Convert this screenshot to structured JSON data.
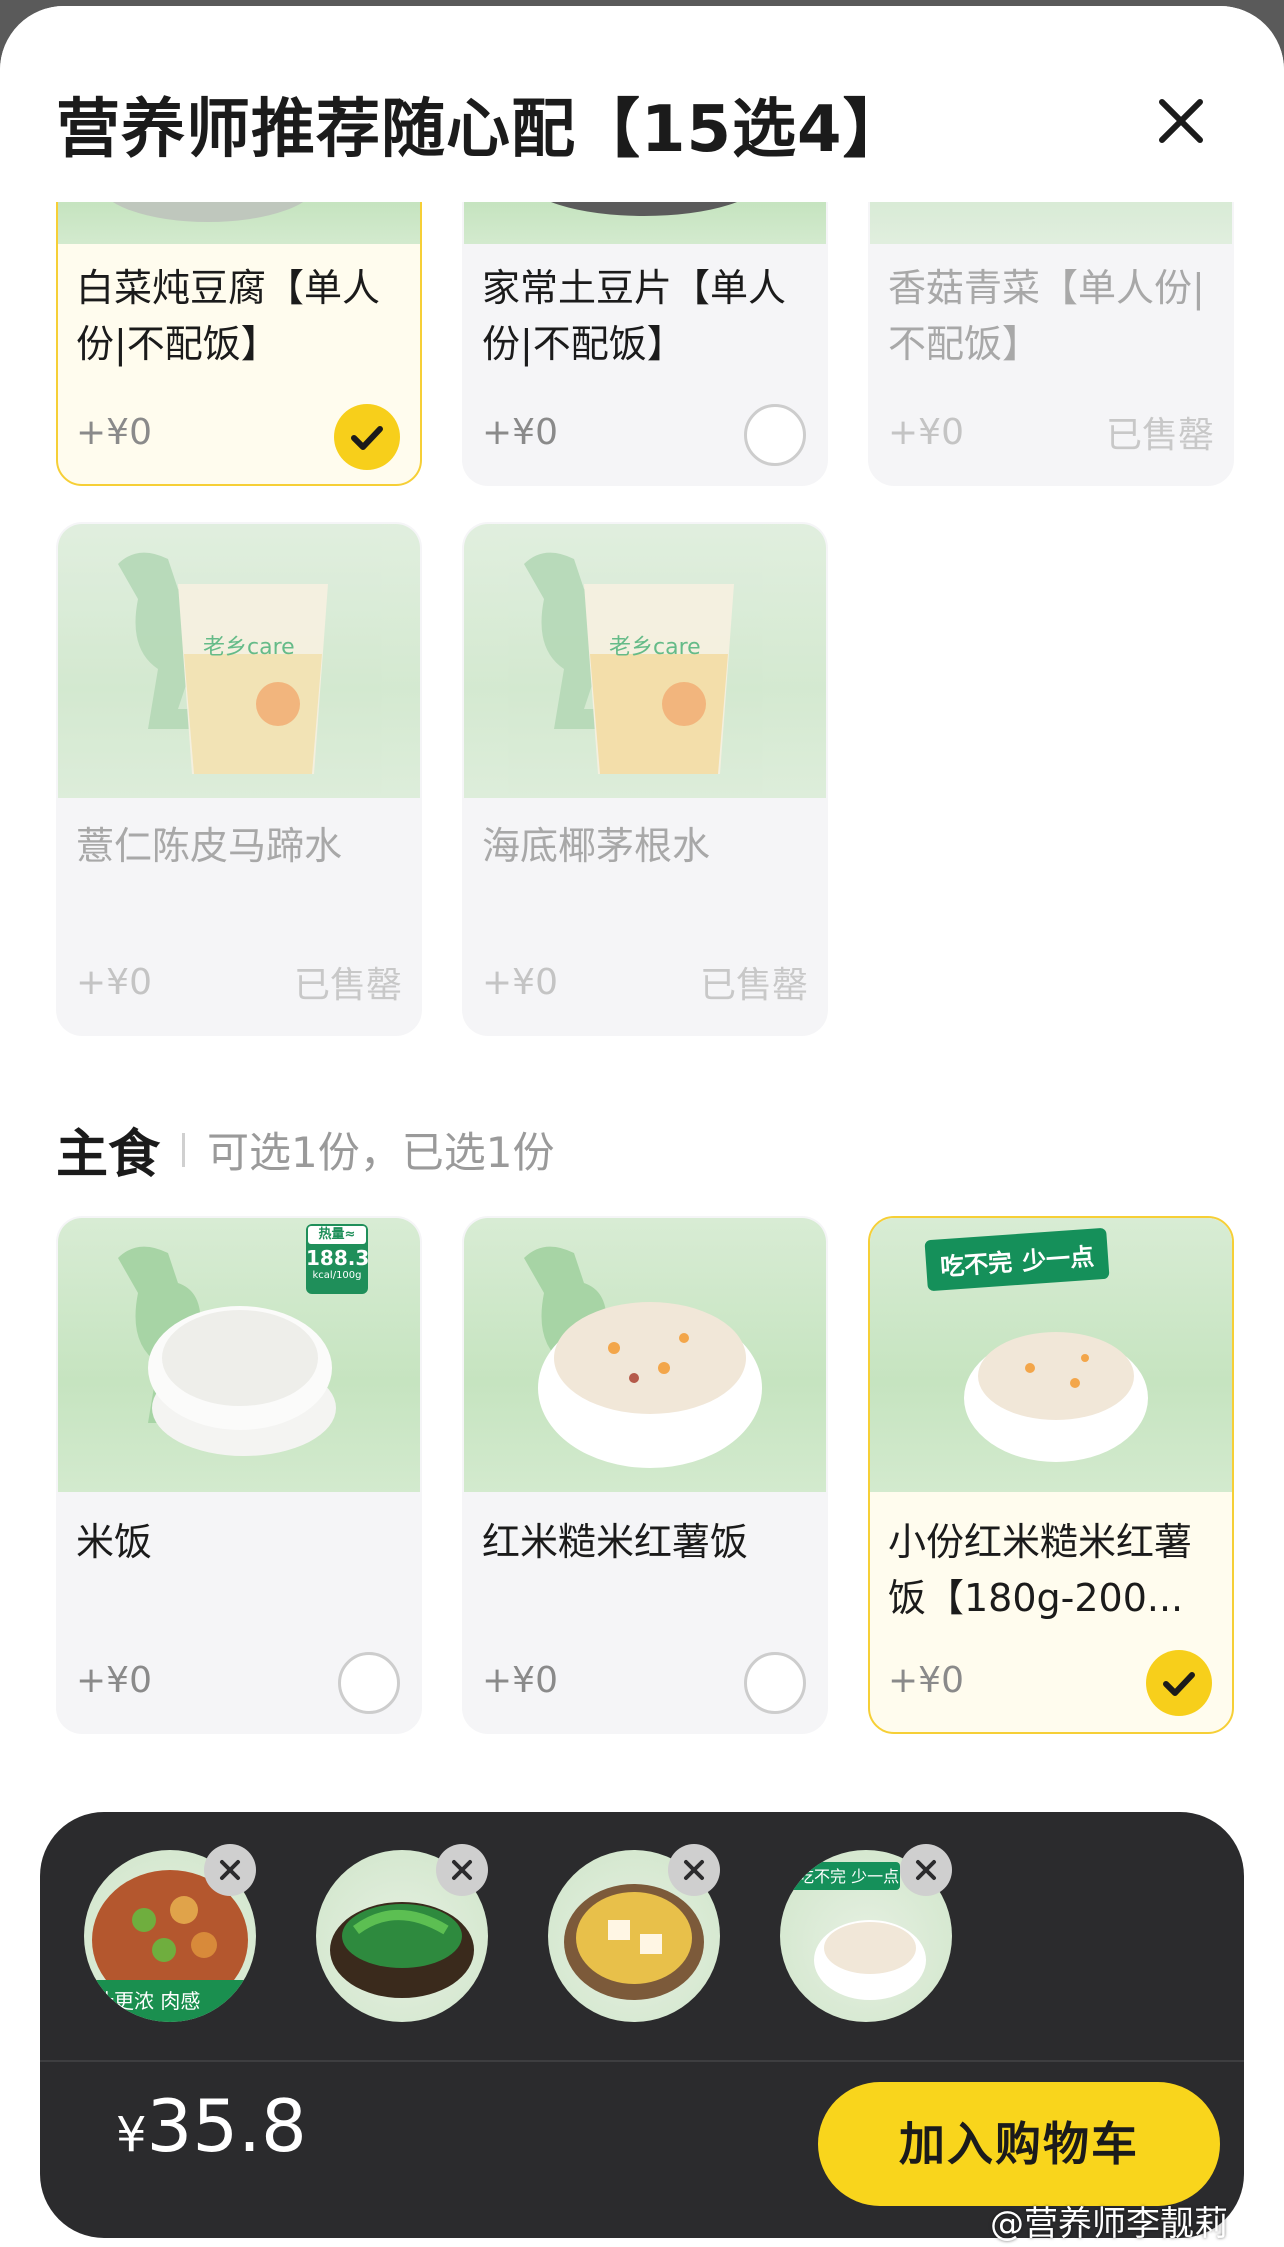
{
  "header": {
    "title": "营养师推荐随心配【15选4】",
    "close_icon": "close-icon"
  },
  "side_items": [
    {
      "name": "白菜炖豆腐【单人份|不配饭】",
      "price": "+¥0",
      "state": "selected"
    },
    {
      "name": "家常土豆片【单人份|不配饭】",
      "price": "+¥0",
      "state": "unselected"
    },
    {
      "name": "香菇青菜【单人份|不配饭】",
      "price": "+¥0",
      "state": "soldout",
      "sold_label": "已售罄"
    },
    {
      "name": "薏仁陈皮马蹄水",
      "price": "+¥0",
      "state": "soldout",
      "sold_label": "已售罄"
    },
    {
      "name": "海底椰茅根水",
      "price": "+¥0",
      "state": "soldout",
      "sold_label": "已售罄"
    }
  ],
  "drink_brand": "老乡care",
  "staple_section": {
    "title": "主食",
    "subtitle": "可选1份，已选1份"
  },
  "staple_items": [
    {
      "name": "米饭",
      "price": "+¥0",
      "state": "unselected",
      "badge": {
        "line1": "热量≈",
        "line2": "188.3",
        "line3": "kcal/100g"
      }
    },
    {
      "name": "红米糙米红薯饭",
      "price": "+¥0",
      "state": "unselected"
    },
    {
      "name": "小份红米糙米红薯饭【180g-200...",
      "price": "+¥0",
      "state": "selected",
      "badge_left": "吃不完",
      "badge_right": "少一点"
    }
  ],
  "cart": {
    "thumbnails": [
      "dish-1-thumbnail",
      "greens-thumbnail",
      "tofu-thumbnail",
      "rice-thumbnail"
    ],
    "thumb1_caption": "汁更浓 肉感",
    "thumb4_caption": "吃不完 少一点",
    "currency": "¥",
    "total": "35.8",
    "add_button": "加入购物车"
  },
  "watermark": "@营养师李靓莉",
  "colors": {
    "accent": "#f9d51c",
    "selected_border": "#f6cf36",
    "cart_bg": "#2b2b2d",
    "green_badge": "#15905a"
  }
}
